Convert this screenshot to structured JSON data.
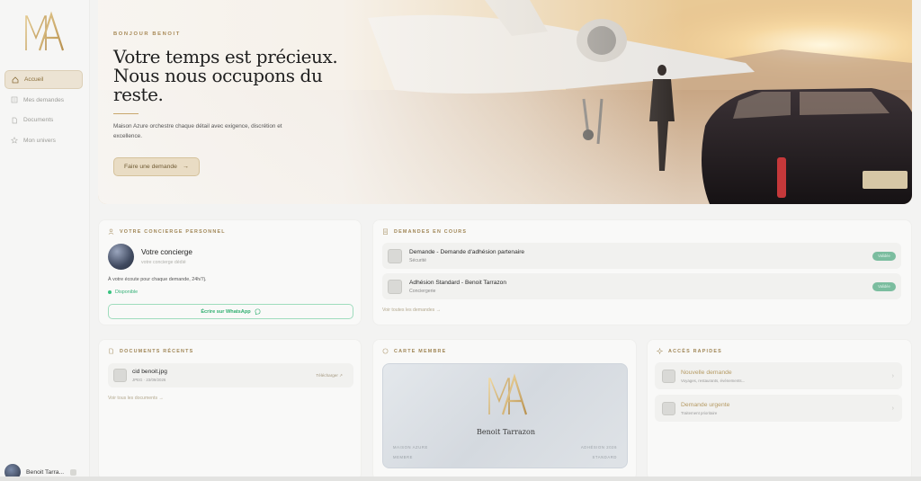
{
  "brand": {
    "gold": "#c9a86d",
    "gold_dark": "#8a6e3a",
    "green": "#38b279"
  },
  "sidebar": {
    "items": [
      {
        "label": "Accueil",
        "icon": "home-icon",
        "active": true
      },
      {
        "label": "Mes demandes",
        "icon": "list-icon",
        "active": false
      },
      {
        "label": "Documents",
        "icon": "document-icon",
        "active": false
      },
      {
        "label": "Mon univers",
        "icon": "star-icon",
        "active": false
      }
    ],
    "user": {
      "name": "Benoit Tarra..."
    }
  },
  "hero": {
    "eyebrow": "BONJOUR BENOIT",
    "title_line1": "Votre temps est précieux.",
    "title_line2": "Nous nous occupons du",
    "title_line3": "reste.",
    "description": "Maison Azure orchestre chaque détail avec exigence, discrétion et excellence.",
    "cta_label": "Faire une demande",
    "cta_arrow": "→"
  },
  "concierge": {
    "heading": "VOTRE CONCIERGE PERSONNEL",
    "name": "Votre concierge",
    "subtitle": "votre concierge dédié",
    "info": "À votre écoute pour chaque demande, 24h/7j.",
    "status": "Disponible",
    "whatsapp_label": "Écrire sur WhatsApp"
  },
  "requests": {
    "heading": "DEMANDES EN COURS",
    "items": [
      {
        "title": "Demande - Demande d'adhésion partenaire",
        "subtitle": "Sécurité",
        "badge": "Validée"
      },
      {
        "title": "Adhésion Standard - Benoit Tarrazon",
        "subtitle": "Conciergerie",
        "badge": "Validée"
      }
    ],
    "see_all": "Voir toutes les demandes →"
  },
  "documents": {
    "heading": "DOCUMENTS RÉCENTS",
    "items": [
      {
        "name": "cid benoit.jpg",
        "meta": "JPEG · 23/09/2026",
        "action": "Télécharger ↗"
      }
    ],
    "see_all": "Voir tous les documents →"
  },
  "member": {
    "heading": "CARTE MEMBRE",
    "name": "Benoit Tarrazon",
    "left1": "MAISON AZURE",
    "left2": "MEMBRE",
    "right1": "ADHÉSION 2026",
    "right2": "STANDARD"
  },
  "quick": {
    "heading": "ACCÈS RAPIDES",
    "items": [
      {
        "title": "Nouvelle demande",
        "subtitle": "Voyages, restaurants, événements..."
      },
      {
        "title": "Demande urgente",
        "subtitle": "Traitement prioritaire"
      }
    ],
    "chevron": "›"
  }
}
